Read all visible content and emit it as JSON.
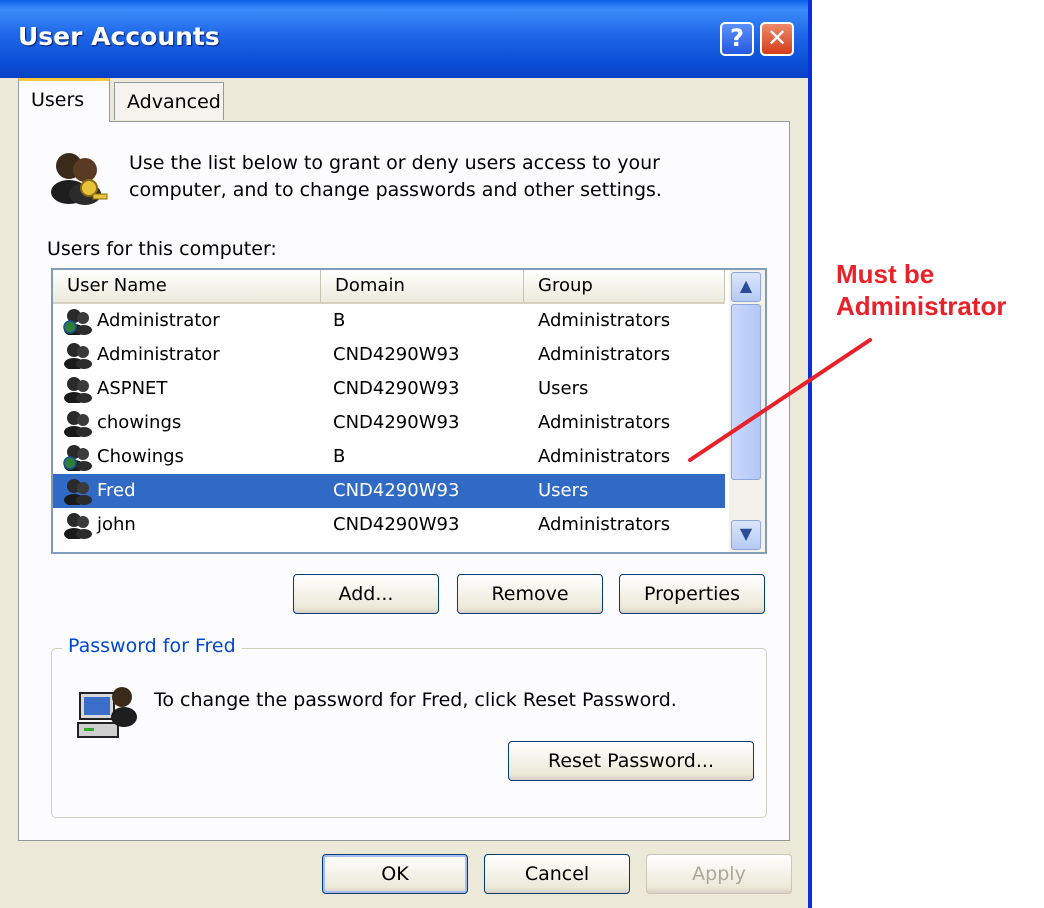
{
  "window": {
    "title": "User Accounts",
    "help_label": "?",
    "close_label": "✕"
  },
  "tabs": [
    {
      "label": "Users",
      "active": true
    },
    {
      "label": "Advanced",
      "active": false
    }
  ],
  "intro": {
    "icon": "users-key-icon",
    "text": "Use the list below to grant or deny users access to your computer, and to change passwords and other settings."
  },
  "users_list": {
    "label": "Users for this computer:",
    "columns": [
      "User Name",
      "Domain",
      "Group"
    ],
    "rows": [
      {
        "name": "Administrator",
        "domain": "B",
        "group": "Administrators",
        "selected": false,
        "icon": "globe-user-icon"
      },
      {
        "name": "Administrator",
        "domain": "CND4290W93",
        "group": "Administrators",
        "selected": false,
        "icon": "user-icon"
      },
      {
        "name": "ASPNET",
        "domain": "CND4290W93",
        "group": "Users",
        "selected": false,
        "icon": "user-icon"
      },
      {
        "name": "chowings",
        "domain": "CND4290W93",
        "group": "Administrators",
        "selected": false,
        "icon": "user-icon"
      },
      {
        "name": "Chowings",
        "domain": "B",
        "group": "Administrators",
        "selected": false,
        "icon": "globe-user-icon"
      },
      {
        "name": "Fred",
        "domain": "CND4290W93",
        "group": "Users",
        "selected": true,
        "icon": "user-icon"
      },
      {
        "name": "john",
        "domain": "CND4290W93",
        "group": "Administrators",
        "selected": false,
        "icon": "user-icon"
      }
    ],
    "scroll_up": "▲",
    "scroll_down": "▼"
  },
  "list_buttons": {
    "add": "Add...",
    "remove": "Remove",
    "properties": "Properties"
  },
  "password_group": {
    "legend": "Password for Fred",
    "text": "To change the password for Fred, click Reset Password.",
    "reset_button": "Reset Password..."
  },
  "footer": {
    "ok": "OK",
    "cancel": "Cancel",
    "apply": "Apply"
  },
  "annotation": {
    "line1": "Must be",
    "line2": "Administrator",
    "color": "#e8212a"
  }
}
